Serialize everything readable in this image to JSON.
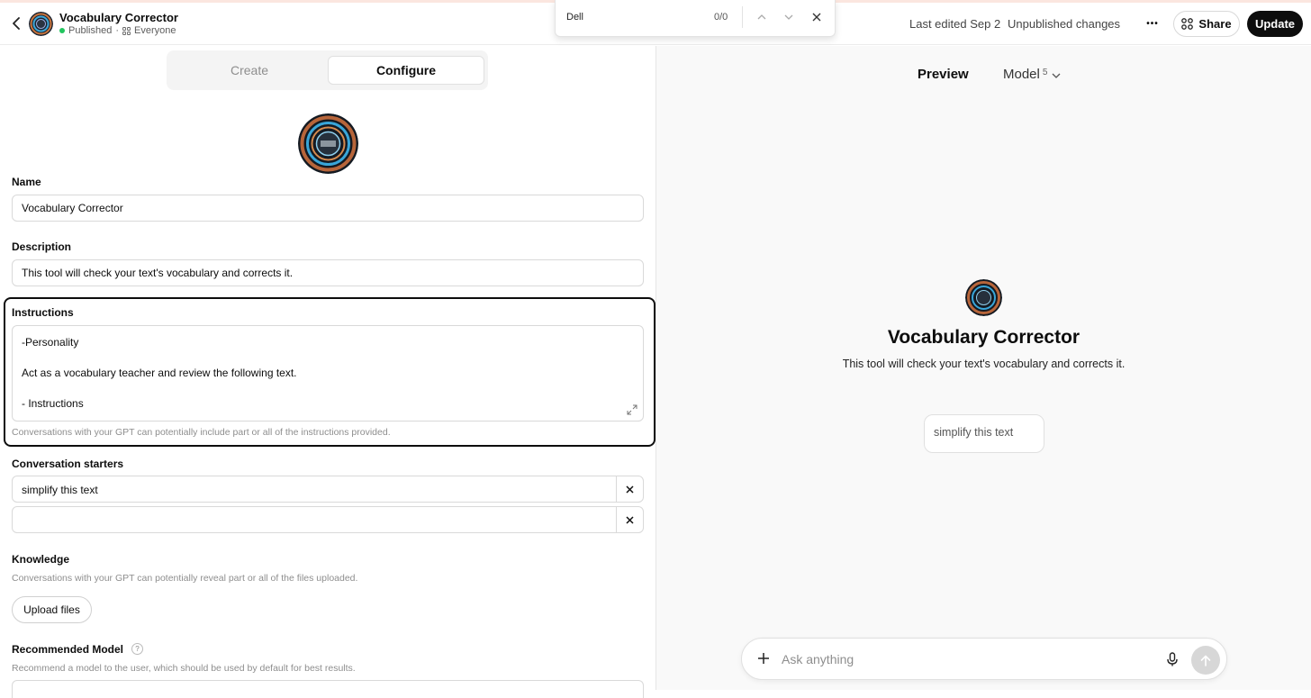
{
  "header": {
    "title": "Vocabulary Corrector",
    "status": "Published",
    "separator": "·",
    "visibility": "Everyone",
    "last_edited": "Last edited Sep 2",
    "unpublished": "Unpublished changes",
    "more_label": "•••",
    "share_label": "Share",
    "update_label": "Update"
  },
  "findbar": {
    "query": "Dell",
    "count": "0/0"
  },
  "tabs": {
    "create": "Create",
    "configure": "Configure"
  },
  "form": {
    "name_label": "Name",
    "name_value": "Vocabulary Corrector",
    "description_label": "Description",
    "description_value": "This tool will check your text's vocabulary and corrects it.",
    "instructions_label": "Instructions",
    "instructions_lines": [
      "-Personality",
      "",
      "Act as a vocabulary teacher and review the following text.",
      "",
      "- Instructions"
    ],
    "instructions_hint": "Conversations with your GPT can potentially include part or all of the instructions provided.",
    "starters_label": "Conversation starters",
    "starters": [
      "simplify this text",
      ""
    ],
    "knowledge_label": "Knowledge",
    "knowledge_hint": "Conversations with your GPT can potentially reveal part or all of the files uploaded.",
    "upload_label": "Upload files",
    "rec_model_label": "Recommended Model",
    "rec_model_help": "?",
    "rec_model_hint": "Recommend a model to the user, which should be used by default for best results."
  },
  "preview": {
    "label": "Preview",
    "model_label": "Model",
    "model_version": "5",
    "title": "Vocabulary Corrector",
    "description": "This tool will check your text's vocabulary and corrects it.",
    "starter": "simplify this text",
    "placeholder": "Ask anything"
  },
  "colors": {
    "published_dot": "#22c55e",
    "update_bg": "#0d0d0d",
    "highlight_border": "#0d0d0d",
    "preview_bg": "#f9f9f9"
  },
  "icons": [
    "chevron-left-icon",
    "share-grid-icon",
    "chevron-up-icon",
    "chevron-down-icon",
    "close-icon",
    "expand-icon",
    "plus-icon",
    "mic-icon",
    "arrow-up-icon",
    "users-icon"
  ]
}
